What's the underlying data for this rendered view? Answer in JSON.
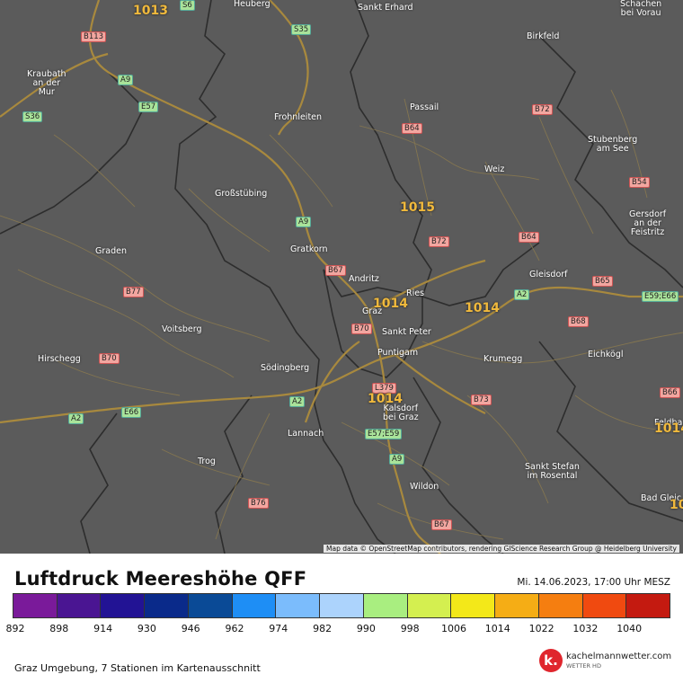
{
  "map": {
    "attribution": "Map data © OpenStreetMap contributors, rendering GIScience Research Group @ Heidelberg University",
    "places": [
      {
        "id": "heuberg",
        "label": "Heuberg"
      },
      {
        "id": "sankt-erhard",
        "label": "Sankt Erhard"
      },
      {
        "id": "schachen",
        "label": "Schachen\nbei Vorau"
      },
      {
        "id": "birkfeld",
        "label": "Birkfeld"
      },
      {
        "id": "kraubath",
        "label": "Kraubath\nan der\nMur"
      },
      {
        "id": "passail",
        "label": "Passail"
      },
      {
        "id": "frohnleiten",
        "label": "Frohnleiten"
      },
      {
        "id": "stubenberg",
        "label": "Stubenberg\nam See"
      },
      {
        "id": "weiz",
        "label": "Weiz"
      },
      {
        "id": "grossstuebing",
        "label": "Großstübing"
      },
      {
        "id": "gersdorf",
        "label": "Gersdorf\nan der\nFeistritz"
      },
      {
        "id": "graden",
        "label": "Graden"
      },
      {
        "id": "gratkorn",
        "label": "Gratkorn"
      },
      {
        "id": "gleisdorf",
        "label": "Gleisdorf"
      },
      {
        "id": "andritz",
        "label": "Andritz"
      },
      {
        "id": "ries",
        "label": "Ries"
      },
      {
        "id": "graz",
        "label": "Graz"
      },
      {
        "id": "voitsberg",
        "label": "Voitsberg"
      },
      {
        "id": "sankt-peter",
        "label": "Sankt Peter"
      },
      {
        "id": "puntigam",
        "label": "Puntigam"
      },
      {
        "id": "hirschegg",
        "label": "Hirschegg"
      },
      {
        "id": "soedingberg",
        "label": "Södingberg"
      },
      {
        "id": "krumegg",
        "label": "Krumegg"
      },
      {
        "id": "eichkoegl",
        "label": "Eichkögl"
      },
      {
        "id": "kalsdorf",
        "label": "Kalsdorf\nbei Graz"
      },
      {
        "id": "lannach",
        "label": "Lannach"
      },
      {
        "id": "trog",
        "label": "Trog"
      },
      {
        "id": "sankt-stefan",
        "label": "Sankt Stefan\nim Rosental"
      },
      {
        "id": "wildon",
        "label": "Wildon"
      },
      {
        "id": "bad-gleich",
        "label": "Bad Gleic"
      },
      {
        "id": "feldbach",
        "label": "Feldba"
      }
    ],
    "shields": [
      {
        "id": "s6",
        "label": "S6",
        "type": "a"
      },
      {
        "id": "b113",
        "label": "B113",
        "type": "b"
      },
      {
        "id": "s35",
        "label": "S35",
        "type": "a"
      },
      {
        "id": "a9-n",
        "label": "A9",
        "type": "a"
      },
      {
        "id": "e57-n",
        "label": "E57",
        "type": "a"
      },
      {
        "id": "s36",
        "label": "S36",
        "type": "a"
      },
      {
        "id": "b72-n",
        "label": "B72",
        "type": "b"
      },
      {
        "id": "b64-n",
        "label": "B64",
        "type": "b"
      },
      {
        "id": "b54",
        "label": "B54",
        "type": "b"
      },
      {
        "id": "a9-m",
        "label": "A9",
        "type": "a"
      },
      {
        "id": "b72-m",
        "label": "B72",
        "type": "b"
      },
      {
        "id": "b64-m",
        "label": "B64",
        "type": "b"
      },
      {
        "id": "b67-n",
        "label": "B67",
        "type": "b"
      },
      {
        "id": "b77",
        "label": "B77",
        "type": "b"
      },
      {
        "id": "b65",
        "label": "B65",
        "type": "b"
      },
      {
        "id": "a2-e",
        "label": "A2",
        "type": "a"
      },
      {
        "id": "e59e66",
        "label": "E59;E66",
        "type": "a"
      },
      {
        "id": "b68",
        "label": "B68",
        "type": "b"
      },
      {
        "id": "b70-c",
        "label": "B70",
        "type": "b"
      },
      {
        "id": "b70-w",
        "label": "B70",
        "type": "b"
      },
      {
        "id": "l379",
        "label": "L379",
        "type": "b"
      },
      {
        "id": "a2-c",
        "label": "A2",
        "type": "a"
      },
      {
        "id": "b73",
        "label": "B73",
        "type": "b"
      },
      {
        "id": "b66",
        "label": "B66",
        "type": "b"
      },
      {
        "id": "a2-w",
        "label": "A2",
        "type": "a"
      },
      {
        "id": "e66",
        "label": "E66",
        "type": "a"
      },
      {
        "id": "e57e59",
        "label": "E57;E59",
        "type": "a"
      },
      {
        "id": "a9-s",
        "label": "A9",
        "type": "a"
      },
      {
        "id": "b76",
        "label": "B76",
        "type": "b"
      },
      {
        "id": "b67-s",
        "label": "B67",
        "type": "b"
      }
    ],
    "pressure_values": [
      {
        "id": "p-nw",
        "value": "1013"
      },
      {
        "id": "p-north",
        "value": "1015"
      },
      {
        "id": "p-graz",
        "value": "1014"
      },
      {
        "id": "p-east",
        "value": "1014"
      },
      {
        "id": "p-south",
        "value": "1014"
      },
      {
        "id": "p-edge",
        "value": "1014"
      },
      {
        "id": "p-edge2",
        "value": "10"
      }
    ]
  },
  "legend": {
    "title": "Luftdruck Meereshöhe QFF",
    "datetime": "Mi. 14.06.2023, 17:00 Uhr MESZ",
    "colors": [
      "#7a1a9a",
      "#4a1592",
      "#221394",
      "#0a2a8a",
      "#0a4a96",
      "#1e8ef5",
      "#7bbcfc",
      "#acd3fc",
      "#a9ee80",
      "#d4ef50",
      "#f3e819",
      "#f5ad15",
      "#f57e10",
      "#f04a10",
      "#c41a10"
    ],
    "ticks": [
      "892",
      "898",
      "914",
      "930",
      "946",
      "962",
      "974",
      "982",
      "990",
      "998",
      "1006",
      "1014",
      "1022",
      "1032",
      "1040"
    ],
    "footer": "Graz Umgebung, 7 Stationen im Kartenausschnitt"
  },
  "logo": {
    "letter": "k.",
    "name": "kachelmannwetter.com",
    "sub": "WETTER HD"
  }
}
